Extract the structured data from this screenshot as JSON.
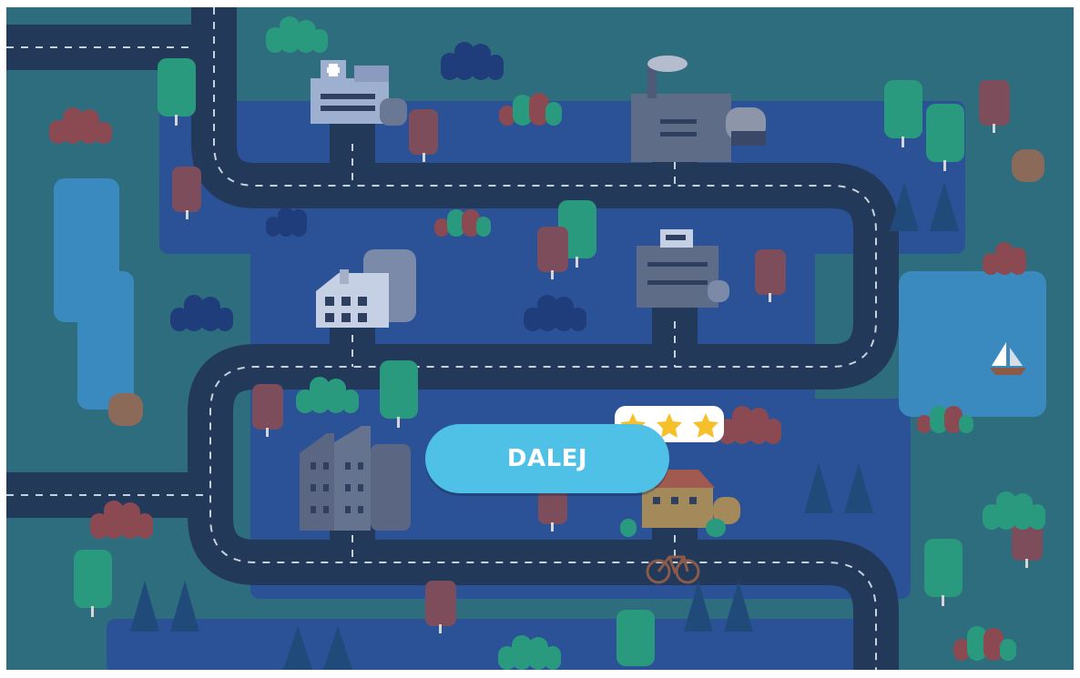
{
  "level_map": {
    "next_button_label": "DALEJ",
    "rating": {
      "stars_earned": 3,
      "stars_total": 3
    },
    "colors": {
      "background": "#2e6d7e",
      "district": "#2b5296",
      "road": "#23395a",
      "lake": "#3a8ac0",
      "button": "#4fc1e6",
      "star": "#f6c02a",
      "tree_green": "#2a9a7e",
      "tree_red": "#7e4d5c",
      "bush_navy": "#1f3d7a",
      "bush_red": "#8b4a52"
    },
    "landmarks": [
      "hospital",
      "factory",
      "school",
      "police-station",
      "apartment-block",
      "house",
      "boat",
      "bicycle"
    ]
  }
}
